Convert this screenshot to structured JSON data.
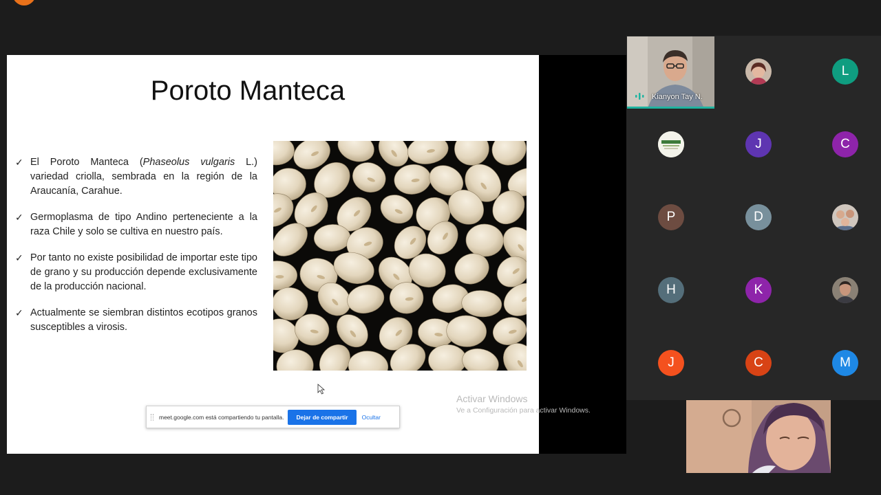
{
  "meeting": {
    "top_text": ""
  },
  "slide": {
    "title": "Poroto Manteca",
    "bullets": [
      {
        "pre": "El Poroto Manteca  (",
        "italic": "Phaseolus vulgaris",
        "post": " L.) variedad criolla, sembrada en la región de la Araucanía, Carahue."
      },
      {
        "text": "Germoplasma de tipo Andino perteneciente a la raza Chile y solo se cultiva en nuestro país."
      },
      {
        "text": "Por tanto no existe posibilidad de importar este tipo de grano y su producción depende exclusivamente de la producción nacional."
      },
      {
        "text": "Actualmente se siembran distintos ecotipos granos susceptibles a virosis."
      }
    ],
    "check_glyph": "✓"
  },
  "share_bar": {
    "message": "meet.google.com está compartiendo tu pantalla.",
    "stop_label": "Dejar de compartir",
    "hide_label": "Ocultar"
  },
  "watermark": {
    "title": "Activar Windows",
    "subtitle": "Ve a Configuración para activar Windows."
  },
  "participants": {
    "speaker_name": "Kianyon Tay N.",
    "tiles": [
      {
        "letter": "L",
        "color": "#0f9d80"
      },
      {
        "letter": "J",
        "color": "#5e35b1"
      },
      {
        "letter": "C",
        "color": "#8e24aa"
      },
      {
        "letter": "P",
        "color": "#6d4c41"
      },
      {
        "letter": "D",
        "color": "#78909c"
      },
      {
        "letter": "H",
        "color": "#546e7a"
      },
      {
        "letter": "K",
        "color": "#8e24aa"
      },
      {
        "letter": "J",
        "color": "#f4511e"
      },
      {
        "letter": "C",
        "color": "#d84315"
      },
      {
        "letter": "M",
        "color": "#1e88e5"
      }
    ]
  },
  "colors": {
    "accent": "#1a73e8",
    "speaking_border": "#1fb4a0"
  }
}
